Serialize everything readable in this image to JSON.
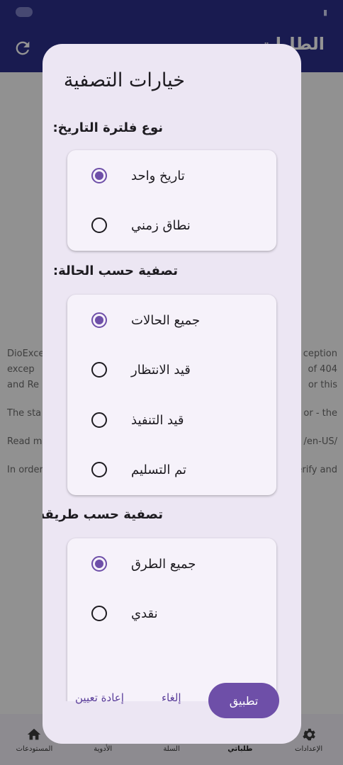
{
  "app_bar": {
    "title": "الطلبات"
  },
  "background_text": {
    "lines": [
      {
        "left": "DioExce",
        "right": "ception"
      },
      {
        "left": "excep",
        "right": "of 404"
      },
      {
        "left": "and Re",
        "right": "or this"
      },
      {
        "left": "The sta",
        "right": "or - the"
      },
      {
        "left": "Read m",
        "right": "/en-US/"
      },
      {
        "left": "In order",
        "right": "erify and"
      }
    ]
  },
  "bottom_nav": {
    "items": [
      {
        "label": "الإعدادات",
        "icon": "gear-icon"
      },
      {
        "label": "طلباتي",
        "icon": "orders-icon",
        "active": true
      },
      {
        "label": "السلة",
        "icon": "cart-icon"
      },
      {
        "label": "الأدوية",
        "icon": "medicine-icon"
      },
      {
        "label": "المستودعات",
        "icon": "home-icon"
      }
    ]
  },
  "dialog": {
    "title": "خيارات التصفية",
    "sections": [
      {
        "label": "نوع فلترة التاريخ:",
        "options": [
          {
            "label": "تاريخ واحد",
            "selected": true
          },
          {
            "label": "نطاق زمني",
            "selected": false
          }
        ]
      },
      {
        "label": "تصفية حسب الحالة:",
        "options": [
          {
            "label": "جميع الحالات",
            "selected": true
          },
          {
            "label": "قيد الانتظار",
            "selected": false
          },
          {
            "label": "قيد التنفيذ",
            "selected": false
          },
          {
            "label": "تم التسليم",
            "selected": false
          }
        ]
      },
      {
        "label": "تصفية حسب طريقة الدفع:",
        "options": [
          {
            "label": "جميع الطرق",
            "selected": true
          },
          {
            "label": "نقدي",
            "selected": false
          }
        ]
      }
    ],
    "actions": {
      "apply": "تطبيق",
      "cancel": "إلغاء",
      "reset": "إعادة تعيين"
    }
  },
  "colors": {
    "primary": "#6e4fa8",
    "app_bar": "#2c2f8a",
    "dialog_bg": "#ece6f3",
    "card_bg": "#f6f2fa"
  }
}
